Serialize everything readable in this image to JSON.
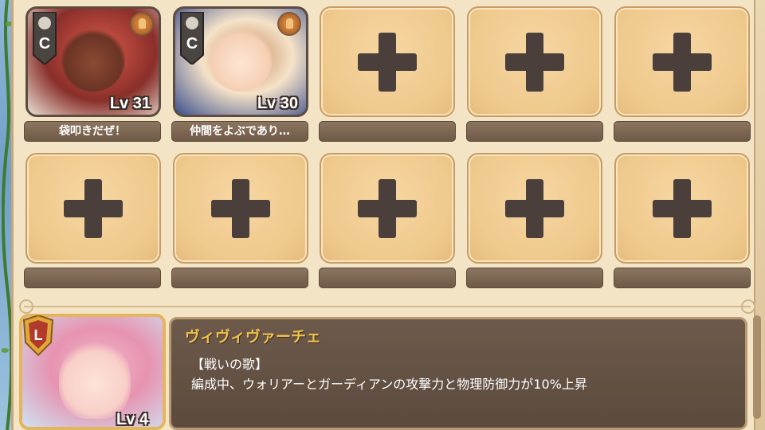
{
  "party": {
    "row1": [
      {
        "type": "character",
        "rank": "C",
        "level": "Lv 31",
        "label": "袋叩きだぜ！",
        "portrait": "red-haired-warrior"
      },
      {
        "type": "character",
        "rank": "C",
        "level": "Lv 30",
        "label": "仲間をよぶであり…",
        "portrait": "brown-haired-girl"
      },
      {
        "type": "empty",
        "label": ""
      },
      {
        "type": "empty",
        "label": ""
      },
      {
        "type": "empty",
        "label": ""
      }
    ],
    "row2": [
      {
        "type": "empty",
        "label": ""
      },
      {
        "type": "empty",
        "label": ""
      },
      {
        "type": "empty",
        "label": ""
      },
      {
        "type": "empty",
        "label": ""
      },
      {
        "type": "empty",
        "label": ""
      }
    ]
  },
  "leader": {
    "rank": "L",
    "level": "Lv 4",
    "name": "ヴィヴィヴァーチェ",
    "skill_name": "【戦いの歌】",
    "skill_desc": "編成中、ウォリアーとガーディアンの攻撃力と物理防御力が10%上昇"
  },
  "colors": {
    "accent_gold": "#f0c24b",
    "slot_fill": "#efc98c",
    "plus_icon": "#4a3f3b",
    "label_bar": "#6f5a47"
  }
}
